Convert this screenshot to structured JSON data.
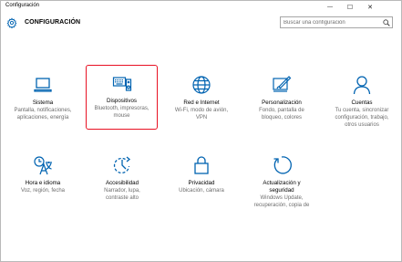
{
  "window": {
    "title": "Configuración",
    "minimize_symbol": "—",
    "maximize_symbol": "☐",
    "close_symbol": "✕"
  },
  "header": {
    "title": "CONFIGURACIÓN",
    "icon": "gear-icon",
    "search_placeholder": "Buscar una configuración",
    "search_value": ""
  },
  "accent_color": "#0063b1",
  "selection_color": "#e81123",
  "tiles": [
    {
      "icon": "laptop-icon",
      "label": "Sistema",
      "desc": "Pantalla, notificaciones,\naplicaciones, energía",
      "selected": false
    },
    {
      "icon": "keyboard-speaker-icon",
      "label": "Dispositivos",
      "desc": "Bluetooth, impresoras,\nmouse",
      "selected": true
    },
    {
      "icon": "globe-icon",
      "label": "Red e Internet",
      "desc": "Wi-Fi, modo de avión,\nVPN",
      "selected": false
    },
    {
      "icon": "paint-icon",
      "label": "Personalización",
      "desc": "Fondo, pantalla de\nbloqueo, colores",
      "selected": false
    },
    {
      "icon": "person-icon",
      "label": "Cuentas",
      "desc": "Tu cuenta, sincronizar\nconfiguración, trabajo,\notros usuarios",
      "selected": false
    },
    {
      "icon": "language-icon",
      "label": "Hora e idioma",
      "desc": "Voz, región, fecha",
      "selected": false
    },
    {
      "icon": "accessibility-icon",
      "label": "Accesibilidad",
      "desc": "Narrador, lupa,\ncontraste alto",
      "selected": false
    },
    {
      "icon": "lock-icon",
      "label": "Privacidad",
      "desc": "Ubicación, cámara",
      "selected": false
    },
    {
      "icon": "update-icon",
      "label": "Actualización y\nseguridad",
      "desc": "Windows Update,\nrecuperación, copia de",
      "selected": false
    }
  ]
}
